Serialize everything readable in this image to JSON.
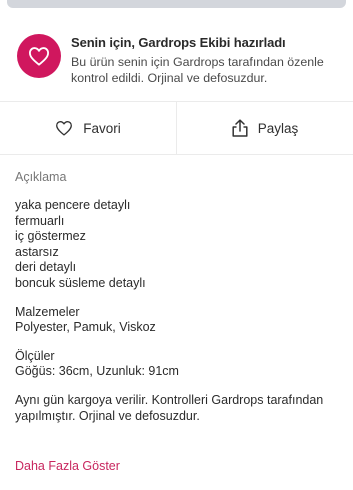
{
  "promo": {
    "icon": "heart-icon",
    "badge_color": "#d0175e",
    "title": "Senin için, Gardrops Ekibi hazırladı",
    "description": "Bu ürün senin için Gardrops tarafından özenle kontrol edildi. Orjinal ve defosuzdur."
  },
  "actions": {
    "favorite": {
      "icon": "heart-outline-icon",
      "label": "Favori"
    },
    "share": {
      "icon": "share-icon",
      "label": "Paylaş"
    }
  },
  "description": {
    "heading": "Açıklama",
    "features": [
      "yaka pencere detaylı",
      "fermuarlı",
      "iç göstermez",
      "astarsız",
      "deri detaylı",
      "boncuk süsleme detaylı"
    ],
    "materials_label": "Malzemeler",
    "materials_value": "Polyester, Pamuk, Viskoz",
    "measurements_label": "Ölçüler",
    "measurements_value": "Göğüs: 36cm, Uzunluk: 91cm",
    "shipping_note": "Aynı gün kargoya verilir. Kontrolleri Gardrops tarafından yapılmıştır. Orjinal ve defosuzdur."
  },
  "more_link": "Daha Fazla Göster",
  "colors": {
    "accent": "#c8275f"
  }
}
